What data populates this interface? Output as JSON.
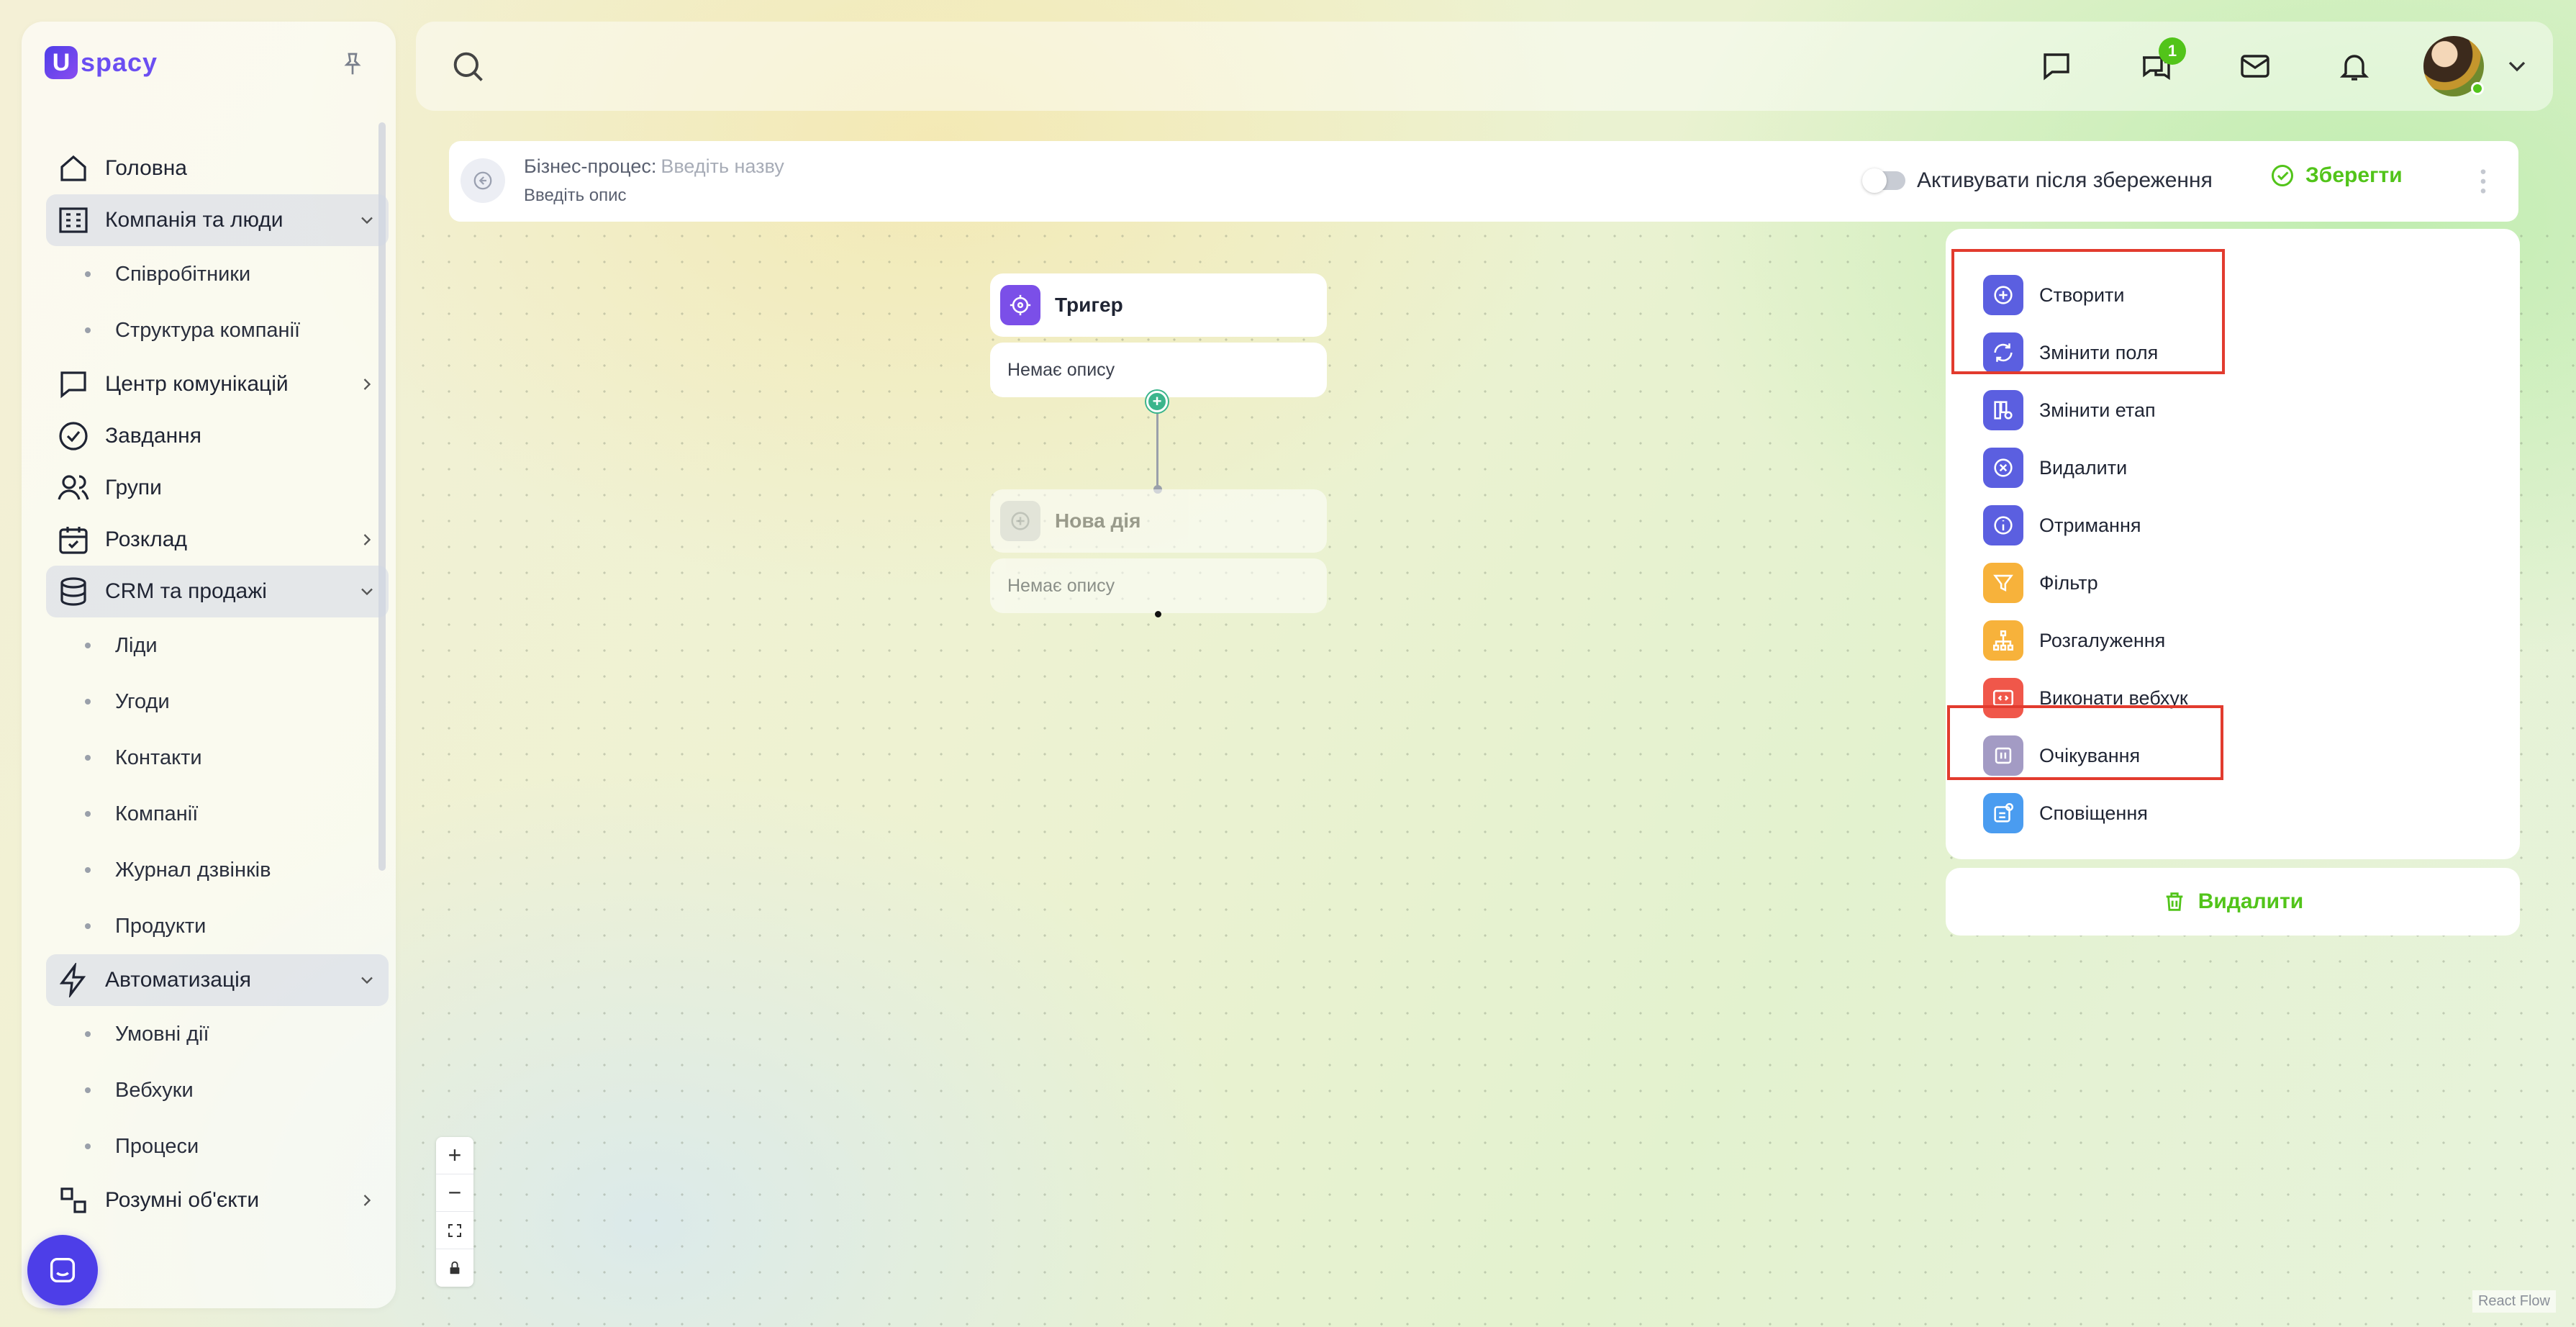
{
  "brand": {
    "logo_mark": "U",
    "logo_text": "spacy"
  },
  "sidebar": {
    "items": [
      {
        "label": "Головна",
        "icon": "home-icon"
      },
      {
        "label": "Компанія та люди",
        "icon": "building-icon",
        "expanded": true,
        "children": [
          "Співробітники",
          "Структура компанії"
        ]
      },
      {
        "label": "Центр комунікацій",
        "icon": "communication-icon"
      },
      {
        "label": "Завдання",
        "icon": "task-check-icon"
      },
      {
        "label": "Групи",
        "icon": "users-icon"
      },
      {
        "label": "Розклад",
        "icon": "calendar-icon"
      },
      {
        "label": "CRM та продажі",
        "icon": "database-icon",
        "expanded": true,
        "children": [
          "Ліди",
          "Угоди",
          "Контакти",
          "Компанії",
          "Журнал дзвінків",
          "Продукти"
        ]
      },
      {
        "label": "Автоматизація",
        "icon": "lightning-icon",
        "expanded": true,
        "children": [
          "Умовні дії",
          "Вебхуки",
          "Процеси"
        ]
      },
      {
        "label": "Розумні об'єкти",
        "icon": "smart-objects-icon"
      }
    ]
  },
  "topbar": {
    "icons": [
      "chat-icon",
      "messages-icon",
      "mail-icon",
      "bell-icon"
    ],
    "messages_badge": "1"
  },
  "process": {
    "title_label": "Бізнес-процес:",
    "title_placeholder": "Введіть назву",
    "description_placeholder": "Введіть опис",
    "activate_label": "Активувати після збереження",
    "activate_on": false,
    "save_label": "Зберегти"
  },
  "flow": {
    "trigger": {
      "title": "Тригер",
      "description": "Немає опису"
    },
    "new_action": {
      "title": "Нова дія",
      "description": "Немає опису"
    }
  },
  "actions": [
    {
      "label": "Створити",
      "icon": "plus-circle-icon",
      "color": "#5b5fe0"
    },
    {
      "label": "Змінити поля",
      "icon": "refresh-icon",
      "color": "#5b5fe0"
    },
    {
      "label": "Змінити етап",
      "icon": "stage-icon",
      "color": "#5b5fe0"
    },
    {
      "label": "Видалити",
      "icon": "x-circle-icon",
      "color": "#5b5fe0"
    },
    {
      "label": "Отримання",
      "icon": "info-icon",
      "color": "#5b5fe0"
    },
    {
      "label": "Фільтр",
      "icon": "filter-icon",
      "color": "#f7b23b"
    },
    {
      "label": "Розгалуження",
      "icon": "branch-icon",
      "color": "#f7b23b"
    },
    {
      "label": "Виконати вебхук",
      "icon": "webhook-icon",
      "color": "#f0574a"
    },
    {
      "label": "Очікування",
      "icon": "pause-icon",
      "color": "#a39bc4"
    },
    {
      "label": "Сповіщення",
      "icon": "notification-icon",
      "color": "#4a9cf0"
    }
  ],
  "delete_label": "Видалити",
  "zoom": {
    "plus": "+",
    "minus": "−"
  },
  "attribution": "React Flow",
  "colors": {
    "accent": "#52c41a",
    "brand": "#4d3ee8",
    "highlight": "#e23b2e"
  }
}
